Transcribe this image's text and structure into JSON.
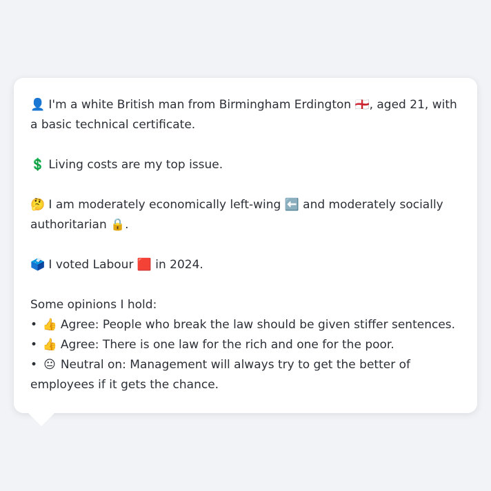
{
  "profile": {
    "identity": {
      "icon": "👤",
      "icon_name": "person-silhouette-icon",
      "text_before": "I'm a white British man from Birmingham Erdington",
      "flag": "🏴󠁧󠁢󠁥󠁮󠁧󠁿",
      "flag_name": "england-flag-icon",
      "text_after": ", aged 21, with a basic technical certificate."
    },
    "issue": {
      "icon": "💲",
      "icon_name": "dollar-sign-icon",
      "text": "Living costs are my top issue."
    },
    "ideology": {
      "icon": "🤔",
      "icon_name": "thinking-face-icon",
      "text_a": "I am moderately economically left-wing",
      "left_icon": "⬅️",
      "left_icon_name": "left-arrow-icon",
      "text_b": "and moderately socially authoritarian",
      "lock_icon": "🔒",
      "lock_icon_name": "lock-icon",
      "text_c": "."
    },
    "vote": {
      "icon": "🗳️",
      "icon_name": "ballot-box-icon",
      "text_a": "I voted Labour",
      "party_icon": "🟥",
      "party_icon_name": "red-square-icon",
      "text_b": "in 2024."
    },
    "opinions": {
      "heading": "Some opinions I hold:",
      "bullet": "•",
      "items": [
        {
          "icon": "👍",
          "icon_name": "thumbs-up-icon",
          "text": "Agree: People who break the law should be given stiffer sentences."
        },
        {
          "icon": "👍",
          "icon_name": "thumbs-up-icon",
          "text": "Agree: There is one law for the rich and one for the poor."
        },
        {
          "icon": "😐",
          "icon_name": "neutral-face-icon",
          "text": "Neutral on: Management will always try to get the better of employees if it gets the chance."
        }
      ]
    }
  },
  "colors": {
    "background": "#f1f3f6",
    "bubble": "#ffffff",
    "text": "#2b2f36"
  }
}
